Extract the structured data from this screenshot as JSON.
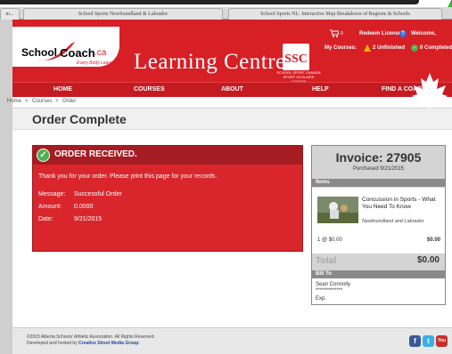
{
  "browser": {
    "tabs": [
      {
        "label": "m..."
      },
      {
        "label": "School Sports Newfoundland & Labrador"
      },
      {
        "label": "School Sports NL: Interactive Map Breakdown of Regions & Schools"
      }
    ]
  },
  "header": {
    "logo_school": "School",
    "logo_coach": "Coach",
    "logo_ca": ".ca",
    "logo_tagline": "Every Body Learns",
    "site_title": "Learning Centre",
    "ssc_logo": "SSC",
    "ssc_text": "SCHOOL SPORT CANADA SPORT SCOLAIRE CANADA",
    "cart_count": "0",
    "redeem_label": "Redeem License",
    "welcome_label": "Welcome,",
    "my_courses_label": "My Courses:",
    "unfinished_label": "2 Unfinished",
    "completed_label": "0 Completed"
  },
  "nav": {
    "items": [
      {
        "label": "HOME"
      },
      {
        "label": "COURSES"
      },
      {
        "label": "ABOUT"
      },
      {
        "label": "HELP"
      },
      {
        "label": "FIND A COACH"
      }
    ]
  },
  "breadcrumb": {
    "home": "Home",
    "sep": ">",
    "courses": "Courses",
    "order": "Order"
  },
  "page": {
    "title": "Order Complete"
  },
  "order": {
    "title": "ORDER RECEIVED.",
    "message_text": "Thank you for your order. Please print this page for your records.",
    "message_label": "Message:",
    "message_value": "Successful Order",
    "amount_label": "Amount:",
    "amount_value": "0.0000",
    "date_label": "Date:",
    "date_value": "9/21/2015"
  },
  "invoice": {
    "title": "Invoice: 27905",
    "purchased": "Purchased 9/21/2015",
    "items_label": "Items",
    "item_name": "Concussion in Sports - What You Need To Know",
    "item_sub": "Newfoundland and Labrador",
    "item_qty": "1 @ $0.00",
    "item_total": "$0.00",
    "total_label": "Total",
    "total_value": "$0.00",
    "bill_to_label": "Bill To",
    "bill_name": "Sean Connolly",
    "bill_card": "*************",
    "bill_exp": "Exp."
  },
  "footer": {
    "copyright": "©2015 Alberta Schools' Athletic Association. All Rights Reserved.",
    "developed_prefix": "Developed and hosted by ",
    "developer": "Creative Street Media Group."
  },
  "colors": {
    "brand_red": "#d71f26",
    "nav_red": "#c41a20",
    "success_green": "#4caf50"
  }
}
